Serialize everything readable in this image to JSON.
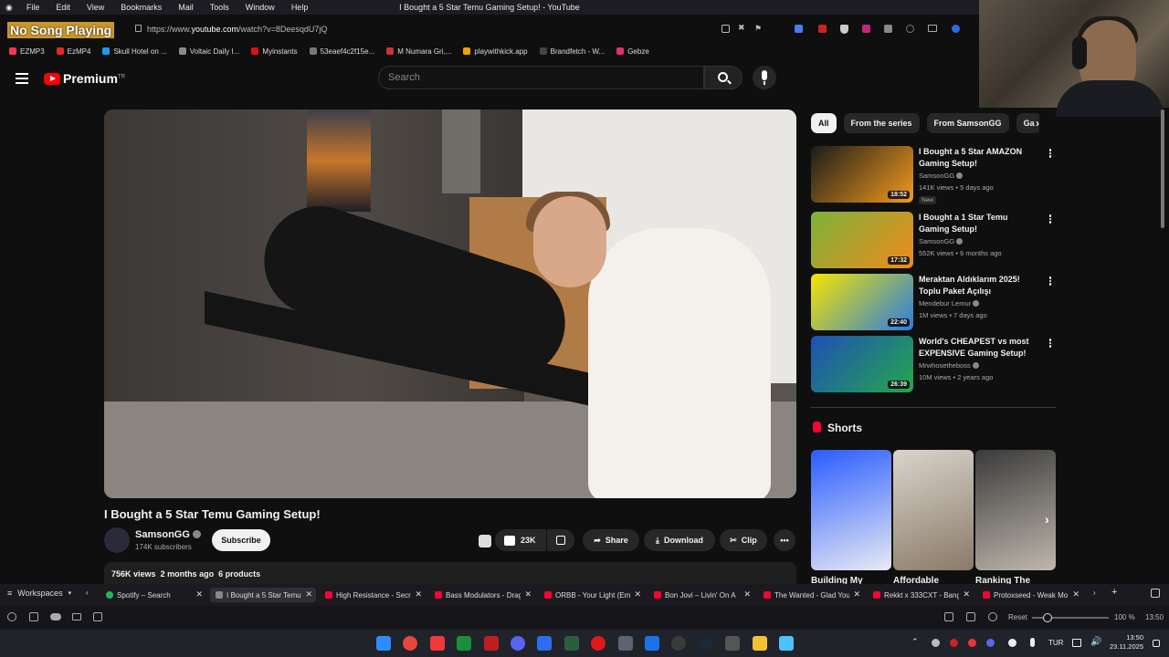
{
  "menubar": {
    "items": [
      "File",
      "Edit",
      "View",
      "Bookmarks",
      "Mail",
      "Tools",
      "Window",
      "Help"
    ],
    "window_title": "I Bought a 5 Star Temu Gaming Setup! - YouTube"
  },
  "overlay": {
    "now_playing": "No Song Playing"
  },
  "address": {
    "url_prefix": "https://www.",
    "url_domain": "youtube.com",
    "url_path": "/watch?v=8DeesqdU7jQ"
  },
  "bookmarks": [
    {
      "label": "EZMP3",
      "color": "#ff3355"
    },
    {
      "label": "EzMP4",
      "color": "#e8271f"
    },
    {
      "label": "Skull Hotel on ...",
      "color": "#1d9bf0"
    },
    {
      "label": "Voltaic Daily I...",
      "color": "#8a8a8a"
    },
    {
      "label": "Myinstants",
      "color": "#d11"
    },
    {
      "label": "53eaef4c2f15e...",
      "color": "#777"
    },
    {
      "label": "M Numara Gri,...",
      "color": "#c33"
    },
    {
      "label": "playwithkick.app",
      "color": "#f4a100"
    },
    {
      "label": "Brandfetch - W...",
      "color": "#444"
    },
    {
      "label": "Gebze",
      "color": "#e1306c"
    }
  ],
  "youtube": {
    "brand": "Premium",
    "brand_region": "TR",
    "search_placeholder": "Search"
  },
  "video": {
    "title": "I Bought a 5 Star Temu Gaming Setup!",
    "channel": "SamsonGG",
    "subscribers": "174K subscribers",
    "subscribe_label": "Subscribe",
    "likes": "23K",
    "share_label": "Share",
    "download_label": "Download",
    "clip_label": "Clip",
    "views": "756K views",
    "age": "2 months ago",
    "products": "6 products"
  },
  "chips": [
    "All",
    "From the series",
    "From SamsonGG",
    "Ga"
  ],
  "recommendations": [
    {
      "title": "I Bought a 5 Star AMAZON Gaming Setup!",
      "channel": "SamsonGG",
      "meta": "141K views • 5 days ago",
      "duration": "18:52",
      "badge": "New",
      "colors": [
        "#1b1b1b",
        "#f39a1e"
      ]
    },
    {
      "title": "I Bought a 1 Star Temu Gaming Setup!",
      "channel": "SamsonGG",
      "meta": "552K views • 6 months ago",
      "duration": "17:32",
      "badge": "",
      "colors": [
        "#7bb33a",
        "#f08a1c"
      ]
    },
    {
      "title": "Meraktan Aldıklarım 2025! Toplu Paket Açılışı",
      "channel": "Mendebur Lemur",
      "meta": "1M views • 7 days ago",
      "duration": "22:40",
      "badge": "",
      "colors": [
        "#f7e400",
        "#2a7de1"
      ]
    },
    {
      "title": "World's CHEAPEST vs most EXPENSIVE Gaming Setup!",
      "channel": "Mrwhosetheboss",
      "meta": "10M views • 2 years ago",
      "duration": "26:39",
      "badge": "",
      "colors": [
        "#1e4fb8",
        "#24a84a"
      ]
    }
  ],
  "shorts": {
    "heading": "Shorts",
    "items": [
      {
        "title": "Building My",
        "colors": [
          "#2a5cff",
          "#e8eaf4"
        ]
      },
      {
        "title": "Affordable",
        "colors": [
          "#d9d4cc",
          "#8a7a68"
        ]
      },
      {
        "title": "Ranking The",
        "colors": [
          "#3a3a3a",
          "#bfb7ad"
        ]
      }
    ]
  },
  "tabbar": {
    "workspaces_label": "Workspaces",
    "tabs": [
      {
        "title": "Spotify – Search",
        "color": "#1db954"
      },
      {
        "title": "I Bought a 5 Star Temu",
        "color": "#888"
      },
      {
        "title": "High Resistance - Secr",
        "color": "#ff0033"
      },
      {
        "title": "Bass Modulators - Drag",
        "color": "#ff0033"
      },
      {
        "title": "ORBB - Your Light (Em",
        "color": "#ff0033"
      },
      {
        "title": "Bon Jovi – Livin' On A",
        "color": "#ff0033"
      },
      {
        "title": "The Wanted - Glad You",
        "color": "#ff0033"
      },
      {
        "title": "Rekkt x 333CXT - Bang",
        "color": "#ff0033"
      },
      {
        "title": "Protoxseed - Weak Mo",
        "color": "#ff0033"
      }
    ]
  },
  "statusbar": {
    "reset_label": "Reset",
    "zoom": "100 %",
    "time": "13:50"
  },
  "taskbar": {
    "language": "TUR",
    "time": "13:50",
    "date": "23.11.2025",
    "apps": [
      {
        "name": "windows-start-icon",
        "color": "#2d8cff"
      },
      {
        "name": "chrome-icon",
        "color": "#e8453c"
      },
      {
        "name": "vivaldi-icon",
        "color": "#ef3939"
      },
      {
        "name": "terminal-icon",
        "color": "#1a8f3a"
      },
      {
        "name": "filezilla-icon",
        "color": "#bf1e1e"
      },
      {
        "name": "discord-icon",
        "color": "#5865f2"
      },
      {
        "name": "editor-icon",
        "color": "#2b6cf0"
      },
      {
        "name": "app-icon",
        "color": "#2b5e3c"
      },
      {
        "name": "recorder-icon",
        "color": "#e01818"
      },
      {
        "name": "window-icon",
        "color": "#5b6470"
      },
      {
        "name": "outlook-icon",
        "color": "#1a73e8"
      },
      {
        "name": "obs-icon",
        "color": "#3a3a3a"
      },
      {
        "name": "steam-icon",
        "color": "#1b2838"
      },
      {
        "name": "settings-icon",
        "color": "#555"
      },
      {
        "name": "folder-icon",
        "color": "#f2c233"
      },
      {
        "name": "notepad-icon",
        "color": "#4cc2ff"
      }
    ]
  }
}
